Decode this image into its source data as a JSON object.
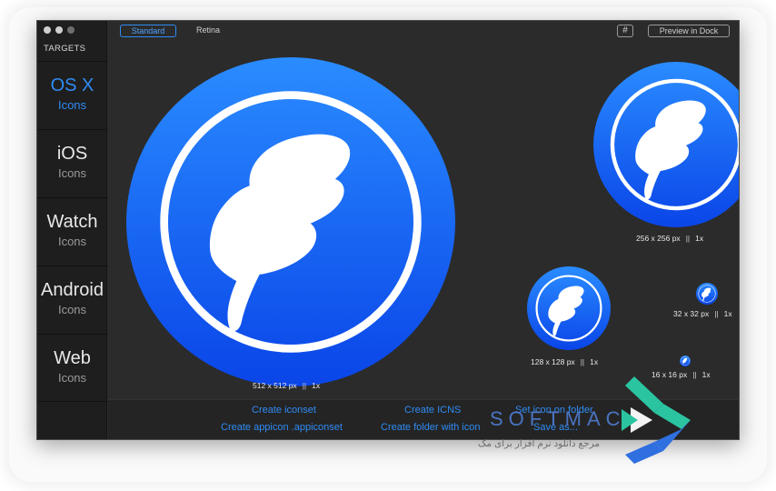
{
  "sidebar": {
    "header": "TARGETS",
    "items": [
      {
        "title": "OS X",
        "subtitle": "Icons",
        "active": true
      },
      {
        "title": "iOS",
        "subtitle": "Icons",
        "active": false
      },
      {
        "title": "Watch",
        "subtitle": "Icons",
        "active": false
      },
      {
        "title": "Android",
        "subtitle": "Icons",
        "active": false
      },
      {
        "title": "Web",
        "subtitle": "Icons",
        "active": false
      }
    ]
  },
  "toolbar": {
    "standard_label": "Standard",
    "retina_label": "Retina",
    "grid_icon": "#",
    "dock_label": "Preview in Dock"
  },
  "icons": [
    {
      "size": "512 x 512 px",
      "sep": "||",
      "scale": "1x"
    },
    {
      "size": "256 x 256 px",
      "sep": "||",
      "scale": "1x"
    },
    {
      "size": "128 x 128 px",
      "sep": "||",
      "scale": "1x"
    },
    {
      "size": "32 x 32 px",
      "sep": "||",
      "scale": "1x"
    },
    {
      "size": "16 x 16 px",
      "sep": "||",
      "scale": "1x"
    }
  ],
  "actions": {
    "create_iconset": "Create iconset",
    "create_appicon": "Create appicon .appiconset",
    "create_icns": "Create ICNS",
    "create_folder": "Create folder with icon",
    "set_icon": "Set icon on folder",
    "save_as": "Save as..."
  },
  "watermark": {
    "brand": "SOFTMAC",
    "tagline": "مرجع دانلود نرم افزار برای مک"
  },
  "colors": {
    "accent": "#2f8cf5",
    "icon_blue_top": "#2a8cff",
    "icon_blue_bottom": "#0a45e8",
    "window_bg": "#2b2b2b",
    "sidebar_bg": "#1e1e1e"
  }
}
